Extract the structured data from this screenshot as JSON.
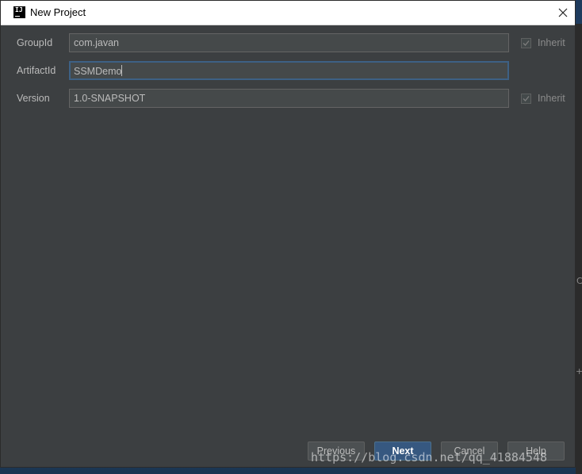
{
  "window": {
    "title": "New Project",
    "app_icon_text": "IJ"
  },
  "form": {
    "group_id": {
      "label": "GroupId",
      "value": "com.javan",
      "inherit_label": "Inherit",
      "inherit_checked": true
    },
    "artifact_id": {
      "label": "ArtifactId",
      "value": "SSMDemo"
    },
    "version": {
      "label": "Version",
      "value": "1.0-SNAPSHOT",
      "inherit_label": "Inherit",
      "inherit_checked": true
    }
  },
  "buttons": {
    "previous": "Previous",
    "next": "Next",
    "cancel": "Cancel",
    "help": "Help"
  },
  "watermark": "https://blog.csdn.net/qq_41884548",
  "background": {
    "mark_1": "C",
    "mark_2": "+"
  },
  "colors": {
    "dialog_bg": "#3c3f41",
    "input_bg": "#45494a",
    "focus_border": "#3d6185",
    "primary_button": "#365880",
    "text": "#bbbbbb"
  }
}
